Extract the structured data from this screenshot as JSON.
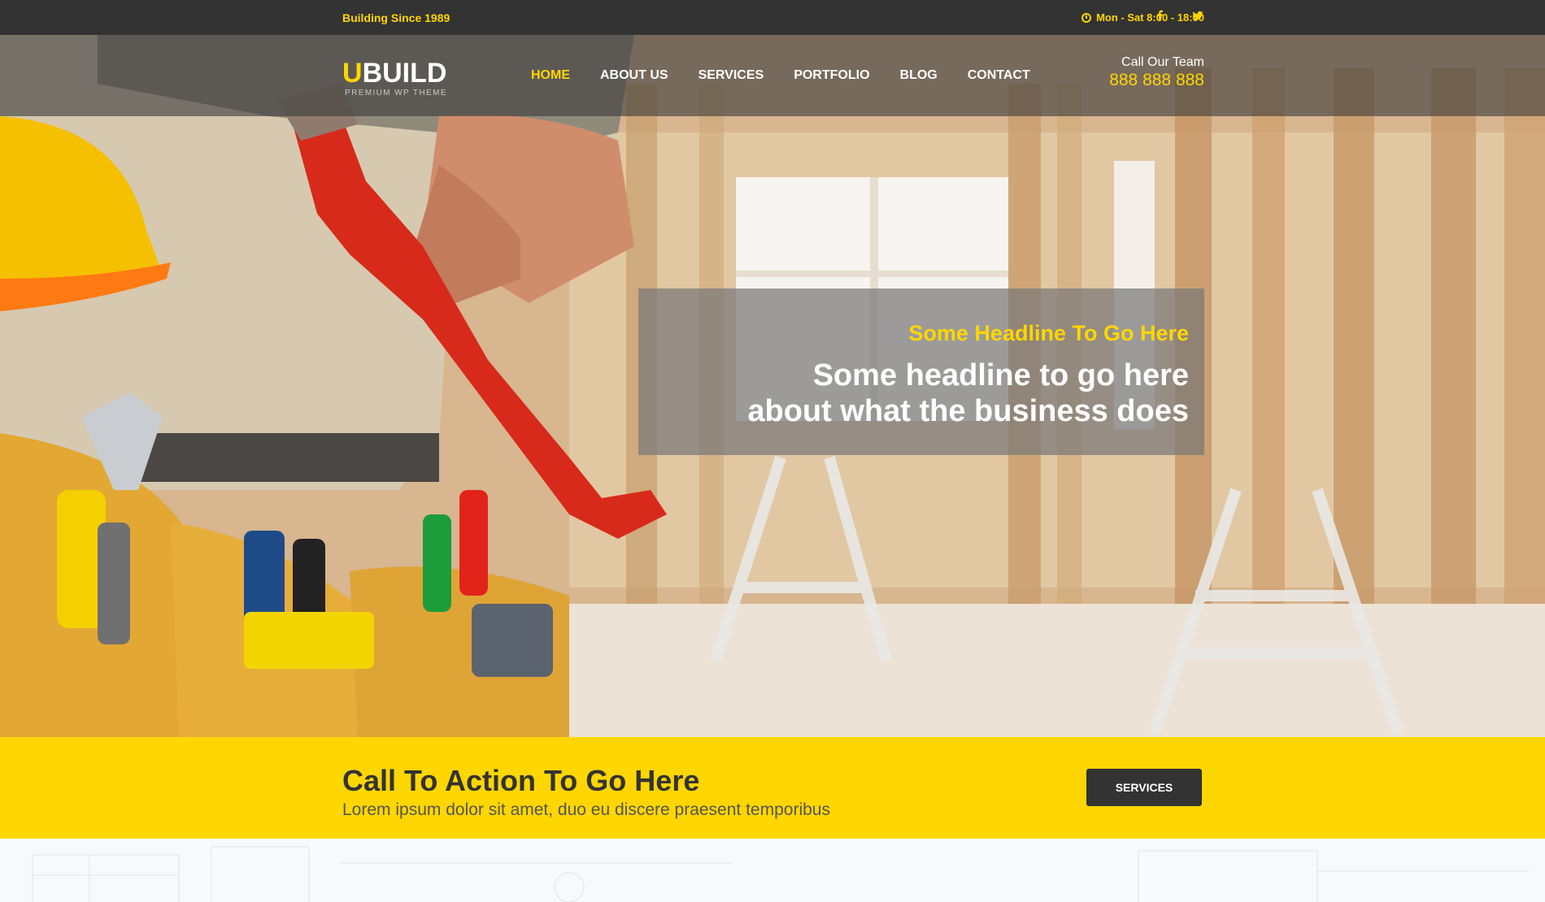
{
  "topbar": {
    "tagline": "Building Since 1989",
    "hours": "Mon - Sat 8:00 - 18:00",
    "clock_icon": "clock-icon",
    "facebook_icon": "facebook-icon",
    "twitter_icon": "twitter-icon"
  },
  "logo": {
    "first_letter": "U",
    "rest": "BUILD",
    "tagline": "PREMIUM WP THEME"
  },
  "nav": {
    "items": [
      {
        "label": "HOME",
        "active": true
      },
      {
        "label": "ABOUT US",
        "active": false
      },
      {
        "label": "SERVICES",
        "active": false
      },
      {
        "label": "PORTFOLIO",
        "active": false
      },
      {
        "label": "BLOG",
        "active": false
      },
      {
        "label": "CONTACT",
        "active": false
      }
    ]
  },
  "call": {
    "label": "Call Our Team",
    "number": "888 888 888"
  },
  "hero": {
    "kicker": "Some Headline To Go Here",
    "line1": "Some headline to go here",
    "line2": "about what the business does"
  },
  "cta": {
    "title": "Call To Action To Go Here",
    "subtitle": "Lorem ipsum dolor sit amet, duo eu discere praesent temporibus",
    "button": "SERVICES"
  },
  "colors": {
    "accent": "#ffd600",
    "dark": "#333333"
  }
}
